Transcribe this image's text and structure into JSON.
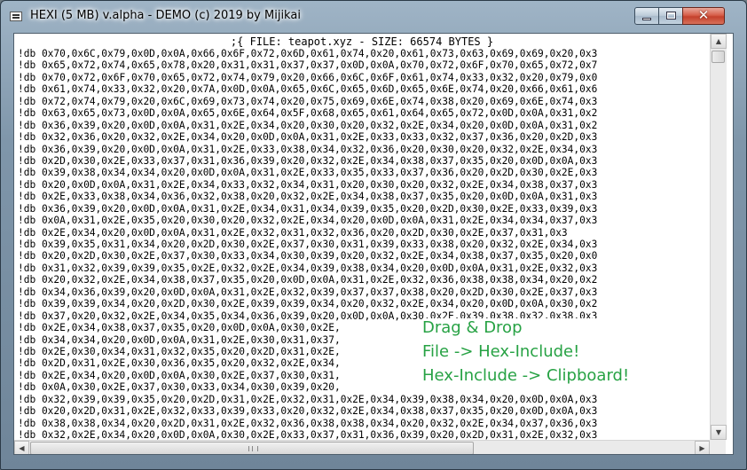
{
  "window": {
    "title": "HEXI (5 MB) v.alpha - DEMO (c) 2019 by Mijikai",
    "close_glyph": "✕"
  },
  "hexview": {
    "header": ";{ FILE: teapot.xyz - SIZE: 66574 BYTES }",
    "lines": [
      "!db 0x70,0x6C,0x79,0x0D,0x0A,0x66,0x6F,0x72,0x6D,0x61,0x74,0x20,0x61,0x73,0x63,0x69,0x69,0x20,0x3",
      "!db 0x65,0x72,0x74,0x65,0x78,0x20,0x31,0x31,0x37,0x37,0x0D,0x0A,0x70,0x72,0x6F,0x70,0x65,0x72,0x7",
      "!db 0x70,0x72,0x6F,0x70,0x65,0x72,0x74,0x79,0x20,0x66,0x6C,0x6F,0x61,0x74,0x33,0x32,0x20,0x79,0x0",
      "!db 0x61,0x74,0x33,0x32,0x20,0x7A,0x0D,0x0A,0x65,0x6C,0x65,0x6D,0x65,0x6E,0x74,0x20,0x66,0x61,0x6",
      "!db 0x72,0x74,0x79,0x20,0x6C,0x69,0x73,0x74,0x20,0x75,0x69,0x6E,0x74,0x38,0x20,0x69,0x6E,0x74,0x3",
      "!db 0x63,0x65,0x73,0x0D,0x0A,0x65,0x6E,0x64,0x5F,0x68,0x65,0x61,0x64,0x65,0x72,0x0D,0x0A,0x31,0x2",
      "!db 0x36,0x39,0x20,0x0D,0x0A,0x31,0x2E,0x34,0x20,0x30,0x20,0x32,0x2E,0x34,0x20,0x0D,0x0A,0x31,0x2",
      "!db 0x32,0x36,0x20,0x32,0x2E,0x34,0x20,0x0D,0x0A,0x31,0x2E,0x33,0x33,0x32,0x37,0x36,0x20,0x2D,0x3",
      "!db 0x36,0x39,0x20,0x0D,0x0A,0x31,0x2E,0x33,0x38,0x34,0x32,0x36,0x20,0x30,0x20,0x32,0x2E,0x34,0x3",
      "!db 0x2D,0x30,0x2E,0x33,0x37,0x31,0x36,0x39,0x20,0x32,0x2E,0x34,0x38,0x37,0x35,0x20,0x0D,0x0A,0x3",
      "!db 0x39,0x38,0x34,0x34,0x20,0x0D,0x0A,0x31,0x2E,0x33,0x35,0x33,0x37,0x36,0x20,0x2D,0x30,0x2E,0x3",
      "!db 0x20,0x0D,0x0A,0x31,0x2E,0x34,0x33,0x32,0x34,0x31,0x20,0x30,0x20,0x32,0x2E,0x34,0x38,0x37,0x3",
      "!db 0x2E,0x33,0x38,0x34,0x36,0x32,0x38,0x20,0x32,0x2E,0x34,0x38,0x37,0x35,0x20,0x0D,0x0A,0x31,0x3",
      "!db 0x36,0x39,0x20,0x0D,0x0A,0x31,0x2E,0x34,0x31,0x34,0x39,0x35,0x20,0x2D,0x30,0x2E,0x33,0x39,0x3",
      "!db 0x0A,0x31,0x2E,0x35,0x20,0x30,0x20,0x32,0x2E,0x34,0x20,0x0D,0x0A,0x31,0x2E,0x34,0x34,0x37,0x3",
      "!db 0x2E,0x34,0x20,0x0D,0x0A,0x31,0x2E,0x32,0x31,0x32,0x36,0x20,0x2D,0x30,0x2E,0x37,0x31,0x3",
      "!db 0x39,0x35,0x31,0x34,0x20,0x2D,0x30,0x2E,0x37,0x30,0x31,0x39,0x33,0x38,0x20,0x32,0x2E,0x34,0x3",
      "!db 0x20,0x2D,0x30,0x2E,0x37,0x30,0x33,0x34,0x30,0x39,0x20,0x32,0x2E,0x34,0x38,0x37,0x35,0x20,0x0",
      "!db 0x31,0x32,0x39,0x39,0x35,0x2E,0x32,0x2E,0x34,0x39,0x38,0x34,0x20,0x0D,0x0A,0x31,0x2E,0x32,0x3",
      "!db 0x20,0x32,0x2E,0x34,0x38,0x37,0x35,0x20,0x0D,0x0A,0x31,0x2E,0x32,0x36,0x38,0x38,0x34,0x20,0x2",
      "!db 0x34,0x36,0x39,0x20,0x0D,0x0A,0x31,0x2E,0x32,0x39,0x37,0x37,0x38,0x20,0x2D,0x30,0x2E,0x37,0x3",
      "!db 0x39,0x39,0x34,0x20,0x2D,0x30,0x2E,0x39,0x39,0x34,0x20,0x32,0x2E,0x34,0x20,0x0D,0x0A,0x30,0x2",
      "!db 0x37,0x20,0x32,0x2E,0x34,0x35,0x34,0x36,0x39,0x20,0x0D,0x0A,0x30,0x2E,0x39,0x38,0x32,0x38,0x3",
      "!db 0x2E,0x34,0x38,0x37,0x35,0x20,0x0D,0x0A,0x30,0x2E,",
      "!db 0x34,0x34,0x20,0x0D,0x0A,0x31,0x2E,0x30,0x31,0x37,",
      "!db 0x2E,0x30,0x34,0x31,0x32,0x35,0x20,0x2D,0x31,0x2E,",
      "!db 0x2D,0x31,0x2E,0x30,0x36,0x35,0x20,0x32,0x2E,0x34,",
      "!db 0x2E,0x34,0x20,0x0D,0x0A,0x30,0x2E,0x37,0x30,0x31,",
      "!db 0x0A,0x30,0x2E,0x37,0x30,0x33,0x34,0x30,0x39,0x20,",
      "!db 0x32,0x39,0x39,0x35,0x20,0x2D,0x31,0x2E,0x32,0x31,0x2E,0x34,0x39,0x38,0x34,0x20,0x0D,0x0A,0x3",
      "!db 0x20,0x2D,0x31,0x2E,0x32,0x33,0x39,0x33,0x20,0x32,0x2E,0x34,0x38,0x37,0x35,0x20,0x0D,0x0A,0x3",
      "!db 0x38,0x38,0x34,0x20,0x2D,0x31,0x2E,0x32,0x36,0x38,0x38,0x34,0x20,0x32,0x2E,0x34,0x37,0x36,0x3",
      "!db 0x32,0x2E,0x34,0x20,0x0D,0x0A,0x30,0x2E,0x33,0x37,0x31,0x36,0x39,0x20,0x2D,0x31,0x2E,0x32,0x3",
      "!db 0x32,0x2E,0x34,0x35,0x34,0x36,0x39,0x20,0x0D,0x0A,0x30,0x2E,0x33,0x37,0x38,0x20,0x2D,0x31,0x2"
    ]
  },
  "help": {
    "line1": "Drag & Drop",
    "line2": "File -> Hex-Include!",
    "line3": "Hex-Include -> Clipboard!"
  },
  "scrollbars": {
    "up_glyph": "▲",
    "down_glyph": "▼",
    "left_glyph": "◀",
    "right_glyph": "▶"
  },
  "colors": {
    "help_text": "#27a244",
    "close_button": "#c4412c"
  }
}
